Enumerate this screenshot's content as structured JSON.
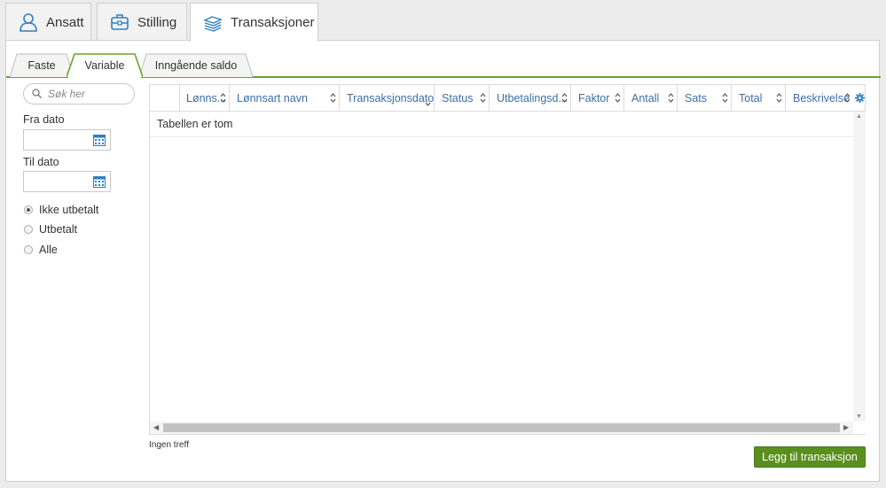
{
  "top_tabs": [
    {
      "label": "Ansatt",
      "icon": "person-icon",
      "active": false
    },
    {
      "label": "Stilling",
      "icon": "briefcase-icon",
      "active": false
    },
    {
      "label": "Transaksjoner",
      "icon": "stack-icon",
      "active": true
    }
  ],
  "sub_tabs": [
    {
      "label": "Faste",
      "active": false
    },
    {
      "label": "Variable",
      "active": true
    },
    {
      "label": "Inngående saldo",
      "active": false
    }
  ],
  "sidebar": {
    "search_placeholder": "Søk her",
    "from_label": "Fra dato",
    "from_value": "",
    "to_label": "Til dato",
    "to_value": "",
    "radios": [
      {
        "label": "Ikke utbetalt",
        "checked": true
      },
      {
        "label": "Utbetalt",
        "checked": false
      },
      {
        "label": "Alle",
        "checked": false
      }
    ]
  },
  "table": {
    "columns": [
      "Lønns...",
      "Lønnsart navn",
      "Transaksjonsdato",
      "Status",
      "Utbetalingsd...",
      "Faktor",
      "Antall",
      "Sats",
      "Total",
      "Beskrivelse"
    ],
    "empty_text": "Tabellen er tom"
  },
  "footer": {
    "status_text": "Ingen treff",
    "add_button": "Legg til transaksjon"
  },
  "colors": {
    "accent_green": "#6aa22e",
    "button_green": "#5a8f1f",
    "header_text_blue": "#3e6ea6",
    "icon_blue": "#2f7fc1"
  }
}
